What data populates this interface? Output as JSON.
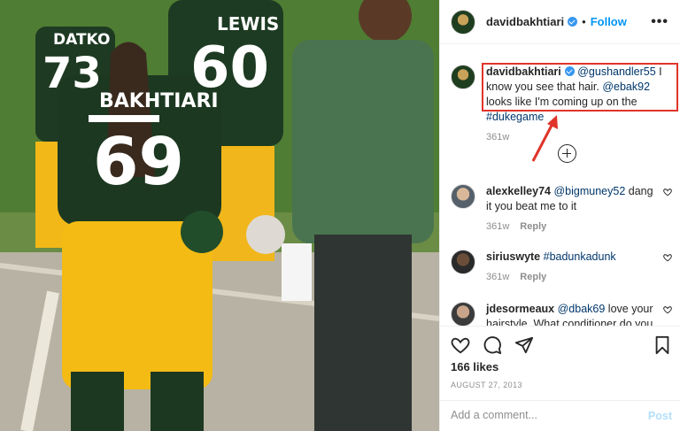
{
  "photo": {
    "jersey_names": [
      "DATKO",
      "LEWIS",
      "BAKHTIARI"
    ],
    "jersey_numbers": [
      "73",
      "60",
      "69"
    ]
  },
  "header": {
    "username": "davidbakhtiari",
    "dot": "•",
    "follow_label": "Follow",
    "more": "•••"
  },
  "caption": {
    "username": "davidbakhtiari",
    "mention1": "@gushandler55",
    "text1": " I know you see that hair. ",
    "mention2": "@ebak92",
    "text2": " looks like I'm coming up on the ",
    "hashtag": "#dukegame",
    "time": "361w"
  },
  "comments": [
    {
      "username": "alexkelley74",
      "mention": "@bigmuney52",
      "text": " dang it you beat me to it",
      "time": "361w",
      "reply": "Reply"
    },
    {
      "username": "siriuswyte",
      "mention": "#badunkadunk",
      "text": "",
      "time": "361w",
      "reply": "Reply"
    },
    {
      "username": "jdesormeaux",
      "mention": "@dbak69",
      "text": " love your hairstyle. What conditioner do you",
      "time": "",
      "reply": ""
    }
  ],
  "likes": "166 likes",
  "date": "AUGUST 27, 2013",
  "add_comment_placeholder": "Add a comment...",
  "post_label": "Post",
  "colors": {
    "accent": "#0095f6",
    "highlight_box": "#e0342a",
    "link": "#00376b"
  },
  "icons": [
    "heart-icon",
    "comment-icon",
    "share-icon",
    "bookmark-icon",
    "plus-circle-icon",
    "more-icon"
  ]
}
